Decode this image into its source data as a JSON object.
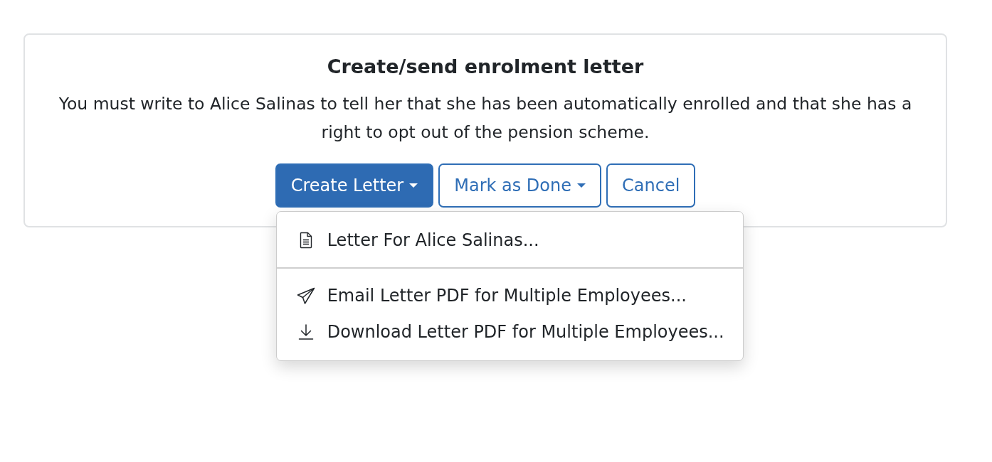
{
  "card": {
    "title": "Create/send enrolment letter",
    "message": "You must write to Alice Salinas to tell her that she has been automatically enrolled and that she has a right to opt out of the pension scheme.",
    "buttons": [
      {
        "label": "Create Letter",
        "kind": "primary",
        "caret": true,
        "expanded": true
      },
      {
        "label": "Mark as Done",
        "kind": "outline",
        "caret": true,
        "expanded": false
      },
      {
        "label": "Cancel",
        "kind": "outline",
        "caret": false,
        "expanded": false
      }
    ]
  },
  "dropdown_menu": {
    "sections": [
      [
        {
          "label": "Letter For Alice Salinas..."
        }
      ],
      [
        {
          "label": "Email Letter PDF for Multiple Employees..."
        },
        {
          "label": "Download Letter PDF for Multiple Employees..."
        }
      ]
    ]
  }
}
